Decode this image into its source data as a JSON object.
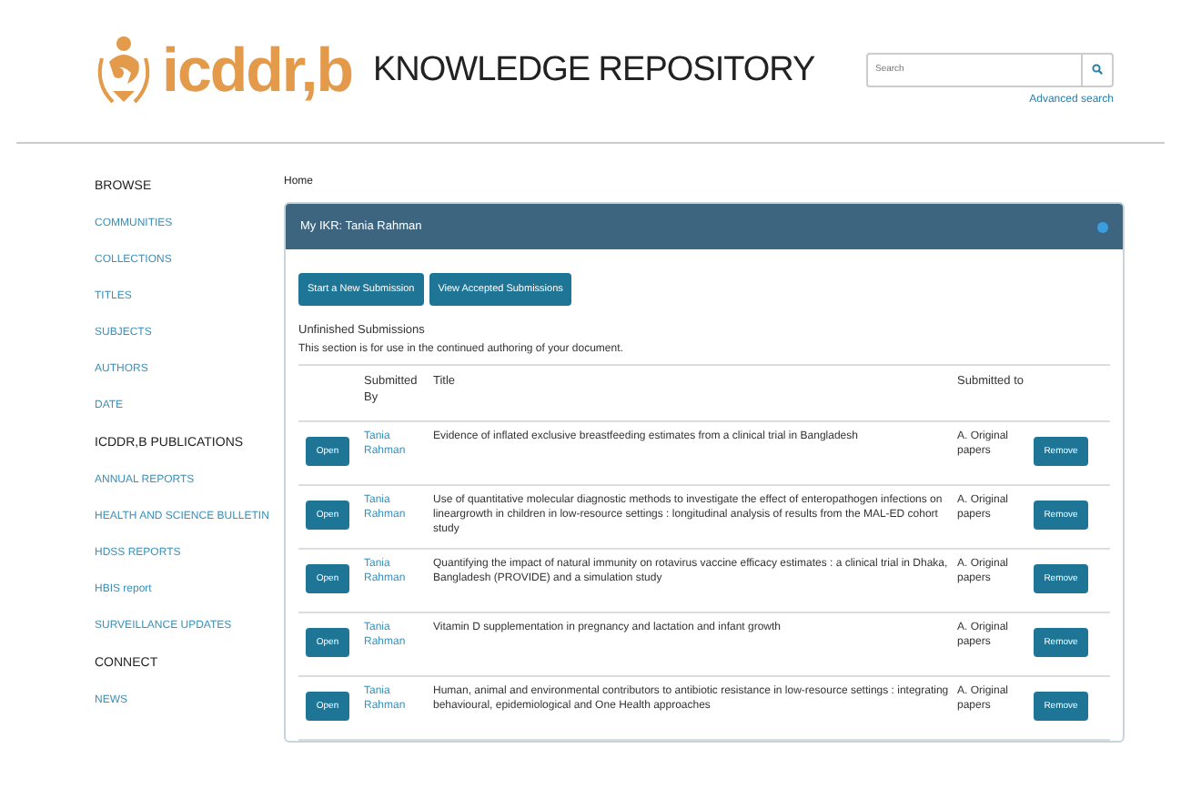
{
  "header": {
    "logo_text": "icddr,b",
    "title": "KNOWLEDGE REPOSITORY",
    "search": {
      "placeholder": "Search"
    },
    "advanced_search": "Advanced search"
  },
  "sidebar": {
    "sections": [
      {
        "heading": "BROWSE",
        "items": [
          "COMMUNITIES",
          "COLLECTIONS",
          "TITLES",
          "SUBJECTS",
          "AUTHORS",
          "DATE"
        ]
      },
      {
        "heading": "ICDDR,B PUBLICATIONS",
        "items": [
          "ANNUAL REPORTS",
          "HEALTH AND SCIENCE BULLETIN",
          "HDSS REPORTS",
          "HBIS report",
          "SURVEILLANCE UPDATES"
        ]
      },
      {
        "heading": "CONNECT",
        "items": [
          "NEWS"
        ]
      }
    ]
  },
  "breadcrumb": "Home",
  "panel": {
    "title": "My IKR: Tania Rahman",
    "buttons": [
      "Start a New Submission",
      "View Accepted Submissions"
    ],
    "section_title": "Unfinished Submissions",
    "description": "This section is for use in the continued authoring of your document.",
    "columns": [
      "Submitted By",
      "Title",
      "Submitted to"
    ],
    "rows": [
      {
        "open": "Open",
        "submitted_by": "Tania Rahman",
        "title": "Evidence of inflated exclusive breastfeeding estimates from a clinical trial in Bangladesh",
        "submitted_to": "A. Original papers",
        "remove": "Remove"
      },
      {
        "open": "Open",
        "submitted_by": "Tania Rahman",
        "title": "Use of quantitative molecular diagnostic methods to investigate the effect of enteropathogen infections on lineargrowth in children in low-resource settings : longitudinal analysis of results from the MAL-ED cohort study",
        "submitted_to": "A. Original papers",
        "remove": "Remove"
      },
      {
        "open": "Open",
        "submitted_by": "Tania Rahman",
        "title": "Quantifying the impact of natural immunity on rotavirus vaccine efficacy estimates : a clinical trial in Dhaka, Bangladesh (PROVIDE) and a simulation study",
        "submitted_to": "A. Original papers",
        "remove": "Remove"
      },
      {
        "open": "Open",
        "submitted_by": "Tania Rahman",
        "title": "Vitamin D supplementation in pregnancy and lactation and infant growth",
        "submitted_to": "A. Original papers",
        "remove": "Remove"
      },
      {
        "open": "Open",
        "submitted_by": "Tania Rahman",
        "title": "Human, animal and environmental contributors to antibiotic resistance in low-resource settings : integrating behavioural, epidemiological and One Health approaches",
        "submitted_to": "A. Original papers",
        "remove": "Remove"
      }
    ]
  }
}
